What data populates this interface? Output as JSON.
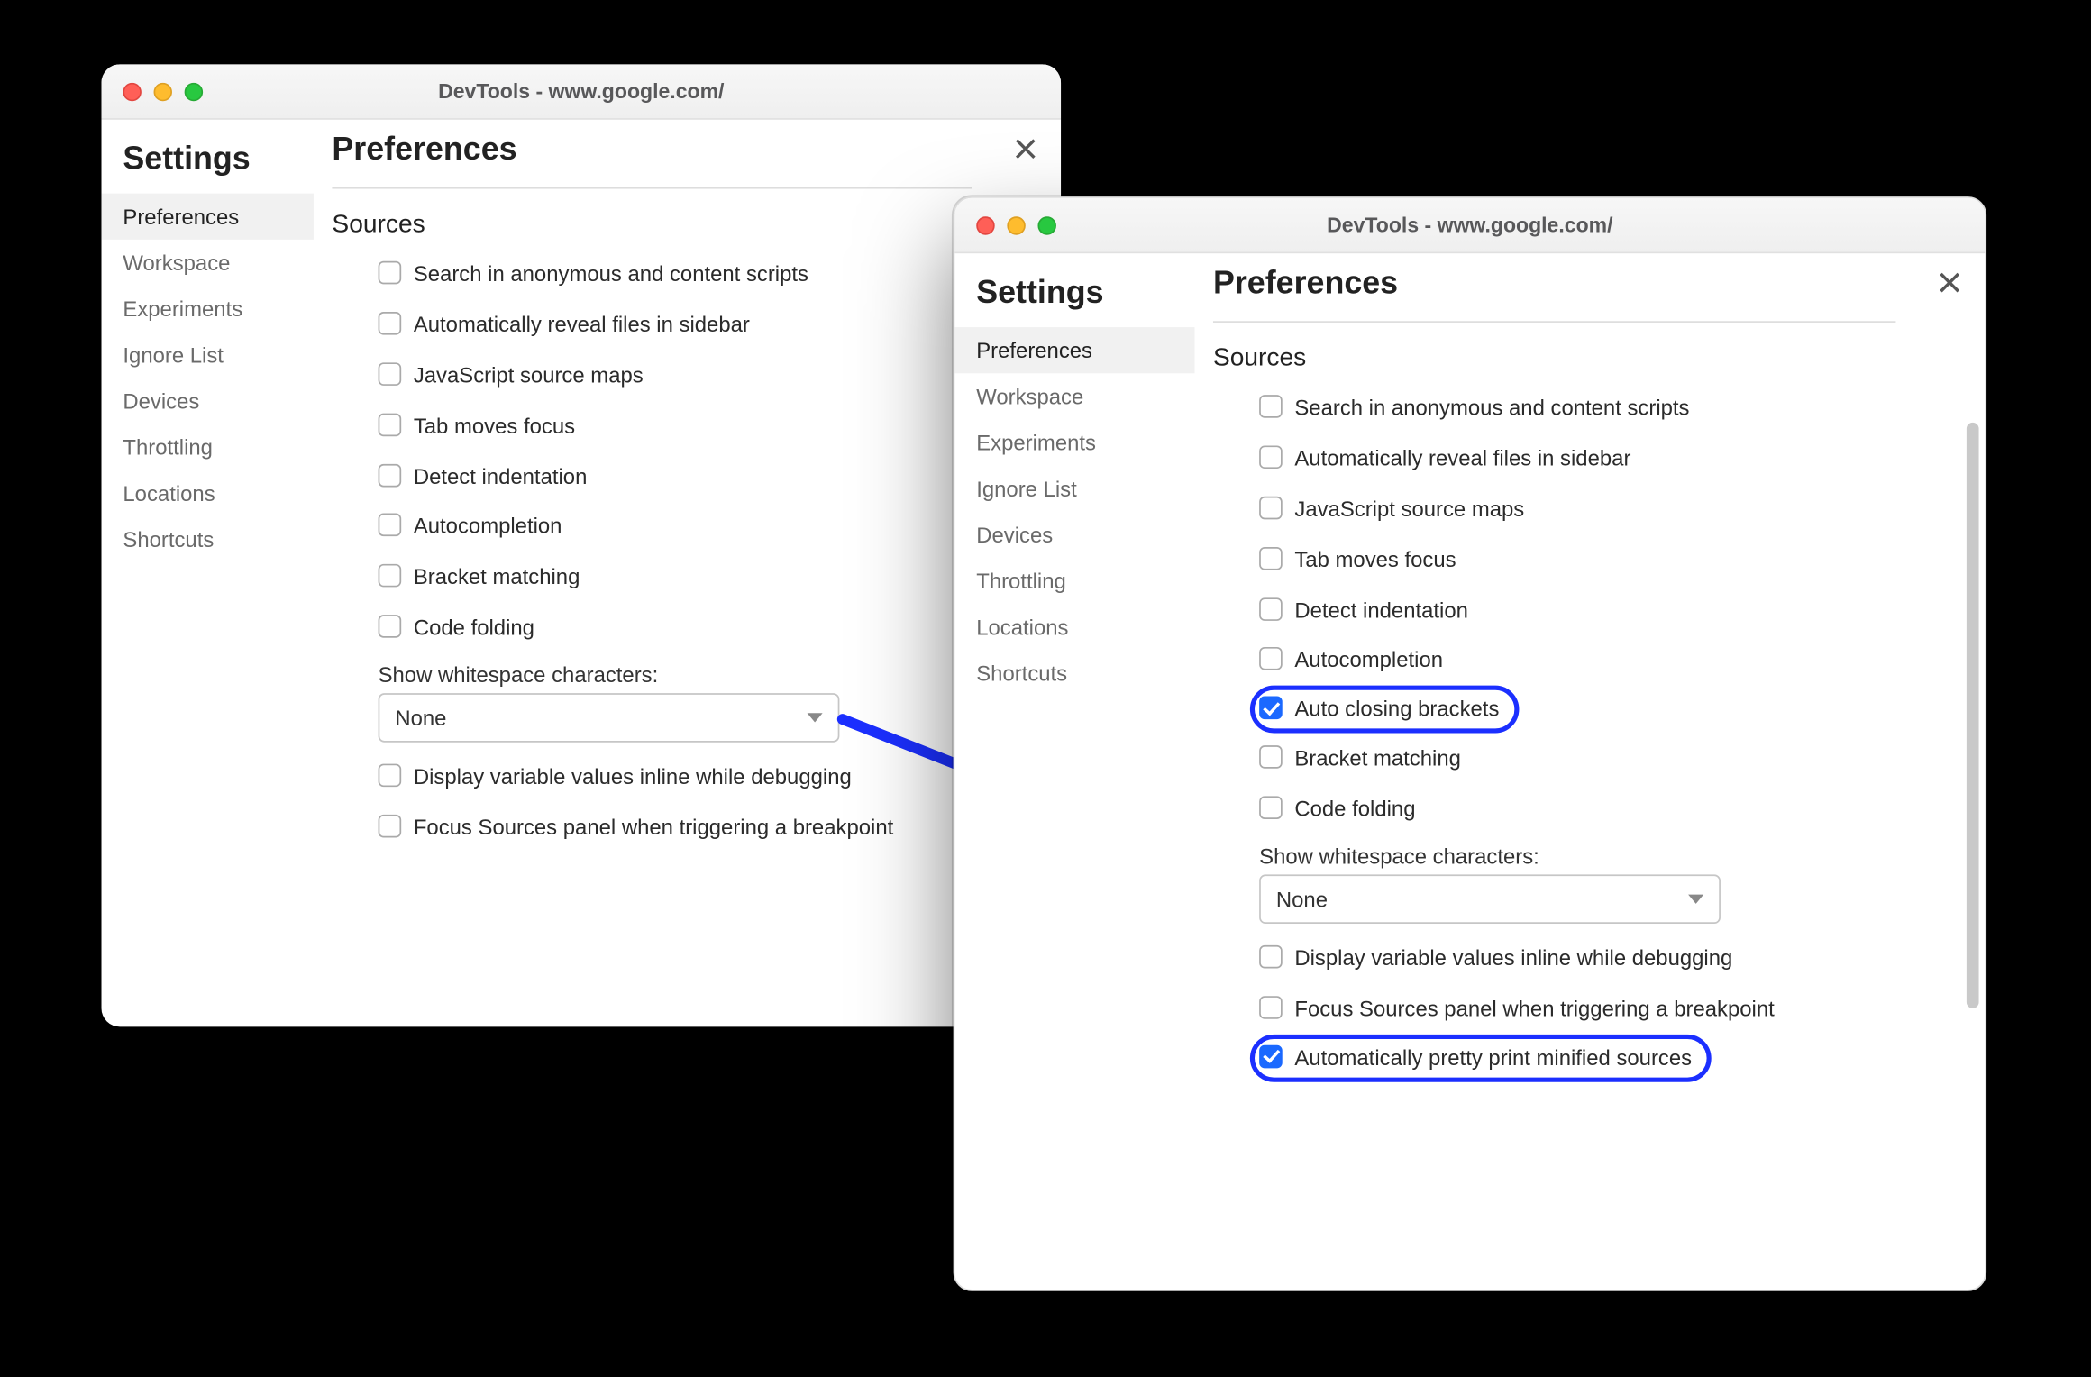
{
  "window_title": "DevTools - www.google.com/",
  "settings_heading": "Settings",
  "prefs_heading": "Preferences",
  "section_heading": "Sources",
  "sidebar": {
    "items": [
      {
        "label": "Preferences",
        "active": true
      },
      {
        "label": "Workspace"
      },
      {
        "label": "Experiments"
      },
      {
        "label": "Ignore List"
      },
      {
        "label": "Devices"
      },
      {
        "label": "Throttling"
      },
      {
        "label": "Locations"
      },
      {
        "label": "Shortcuts"
      }
    ]
  },
  "window_a": {
    "options": [
      {
        "label": "Search in anonymous and content scripts",
        "checked": false
      },
      {
        "label": "Automatically reveal files in sidebar",
        "checked": false
      },
      {
        "label": "JavaScript source maps",
        "checked": false
      },
      {
        "label": "Tab moves focus",
        "checked": false
      },
      {
        "label": "Detect indentation",
        "checked": false
      },
      {
        "label": "Autocompletion",
        "checked": false
      },
      {
        "label": "Bracket matching",
        "checked": false
      },
      {
        "label": "Code folding",
        "checked": false
      }
    ],
    "whitespace": {
      "label": "Show whitespace characters:",
      "value": "None"
    },
    "trailing": [
      {
        "label": "Display variable values inline while debugging",
        "checked": false
      },
      {
        "label": "Focus Sources panel when triggering a breakpoint",
        "checked": false
      }
    ]
  },
  "window_b": {
    "options": [
      {
        "label": "Search in anonymous and content scripts",
        "checked": false
      },
      {
        "label": "Automatically reveal files in sidebar",
        "checked": false
      },
      {
        "label": "JavaScript source maps",
        "checked": false
      },
      {
        "label": "Tab moves focus",
        "checked": false
      },
      {
        "label": "Detect indentation",
        "checked": false
      },
      {
        "label": "Autocompletion",
        "checked": false
      },
      {
        "label": "Auto closing brackets",
        "checked": true,
        "highlight": true
      },
      {
        "label": "Bracket matching",
        "checked": false
      },
      {
        "label": "Code folding",
        "checked": false
      }
    ],
    "whitespace": {
      "label": "Show whitespace characters:",
      "value": "None"
    },
    "trailing": [
      {
        "label": "Display variable values inline while debugging",
        "checked": false
      },
      {
        "label": "Focus Sources panel when triggering a breakpoint",
        "checked": false
      },
      {
        "label": "Automatically pretty print minified sources",
        "checked": true,
        "highlight": true
      }
    ]
  }
}
